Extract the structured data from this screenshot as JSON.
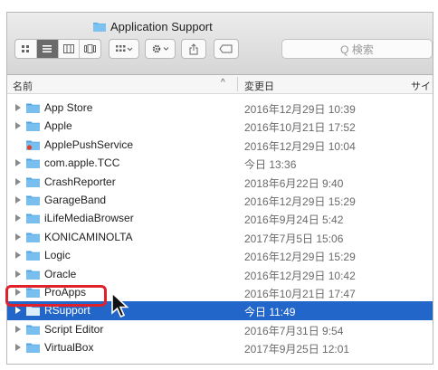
{
  "window": {
    "title": "Application Support",
    "search_placeholder": "Q 検索"
  },
  "toolbar": {
    "view_icon": "icon-view-button",
    "list_icon": "list-view-button",
    "column_icon": "column-view-button",
    "cover_icon": "cover-flow-button",
    "arrange_icon": "arrange-menu",
    "action_icon": "gear-menu",
    "share_icon": "share-button",
    "tag_icon": "tag-button"
  },
  "columns": {
    "name": "名前",
    "date": "変更日",
    "size": "サイ"
  },
  "rows": [
    {
      "name": "App Store",
      "date": "2016年12月29日 10:39",
      "expandable": true
    },
    {
      "name": "Apple",
      "date": "2016年10月21日 17:52",
      "expandable": true
    },
    {
      "name": "ApplePushService",
      "date": "2016年12月29日 10:04",
      "expandable": false,
      "locked": true
    },
    {
      "name": "com.apple.TCC",
      "date": "今日 13:36",
      "expandable": true
    },
    {
      "name": "CrashReporter",
      "date": "2018年6月22日 9:40",
      "expandable": true
    },
    {
      "name": "GarageBand",
      "date": "2016年12月29日 15:29",
      "expandable": true
    },
    {
      "name": "iLifeMediaBrowser",
      "date": "2016年9月24日 5:42",
      "expandable": true
    },
    {
      "name": "KONICAMINOLTA",
      "date": "2017年7月5日 15:06",
      "expandable": true
    },
    {
      "name": "Logic",
      "date": "2016年12月29日 15:29",
      "expandable": true
    },
    {
      "name": "Oracle",
      "date": "2016年12月29日 10:42",
      "expandable": true
    },
    {
      "name": "ProApps",
      "date": "2016年10月21日 17:47",
      "expandable": true
    },
    {
      "name": "RSupport",
      "date": "今日 11:49",
      "expandable": true,
      "selected": true
    },
    {
      "name": "Script Editor",
      "date": "2016年7月31日 9:54",
      "expandable": true
    },
    {
      "name": "VirtualBox",
      "date": "2017年9月25日 12:01",
      "expandable": true
    }
  ],
  "colors": {
    "selection": "#2266c9",
    "folder": "#5aaee8",
    "highlight": "#e0202a"
  }
}
